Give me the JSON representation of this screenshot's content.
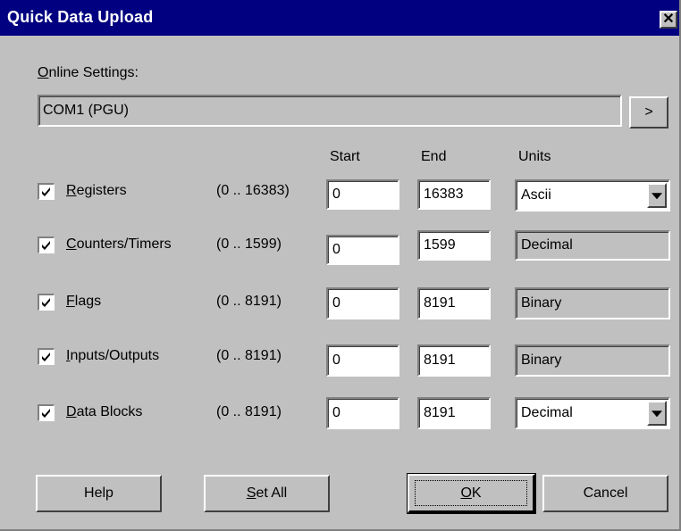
{
  "window": {
    "title": "Quick Data Upload",
    "close_icon": "close-icon"
  },
  "online_settings": {
    "label_hotkey": "O",
    "label_rest": "nline Settings:",
    "value": "COM1 (PGU)",
    "browse_label": ">"
  },
  "columns": {
    "start": "Start",
    "end": "End",
    "units": "Units"
  },
  "rows": [
    {
      "hotkey": "R",
      "rest": "egisters",
      "range": "(0 .. 16383)",
      "start": "0",
      "end": "16383",
      "units": "Ascii",
      "checked": true
    },
    {
      "hotkey": "C",
      "rest": "ounters/Timers",
      "range": "(0 .. 1599)",
      "start": "0",
      "end": "1599",
      "units": "Decimal",
      "checked": true
    },
    {
      "hotkey": "F",
      "rest": "lags",
      "range": "(0 .. 8191)",
      "start": "0",
      "end": "8191",
      "units": "Binary",
      "checked": true
    },
    {
      "hotkey": "I",
      "rest": "nputs/Outputs",
      "range": "(0 .. 8191)",
      "start": "0",
      "end": "8191",
      "units": "Binary",
      "checked": true
    },
    {
      "hotkey": "D",
      "rest": "ata Blocks",
      "range": "(0 .. 8191)",
      "start": "0",
      "end": "8191",
      "units": "Decimal",
      "checked": true
    }
  ],
  "buttons": {
    "help": "Help",
    "set_all_hotkey": "S",
    "set_all_rest": "et All",
    "ok_hotkey": "O",
    "ok_rest": "K",
    "cancel": "Cancel"
  },
  "colors": {
    "titlebar": "#000080",
    "face": "#c0c0c0"
  }
}
